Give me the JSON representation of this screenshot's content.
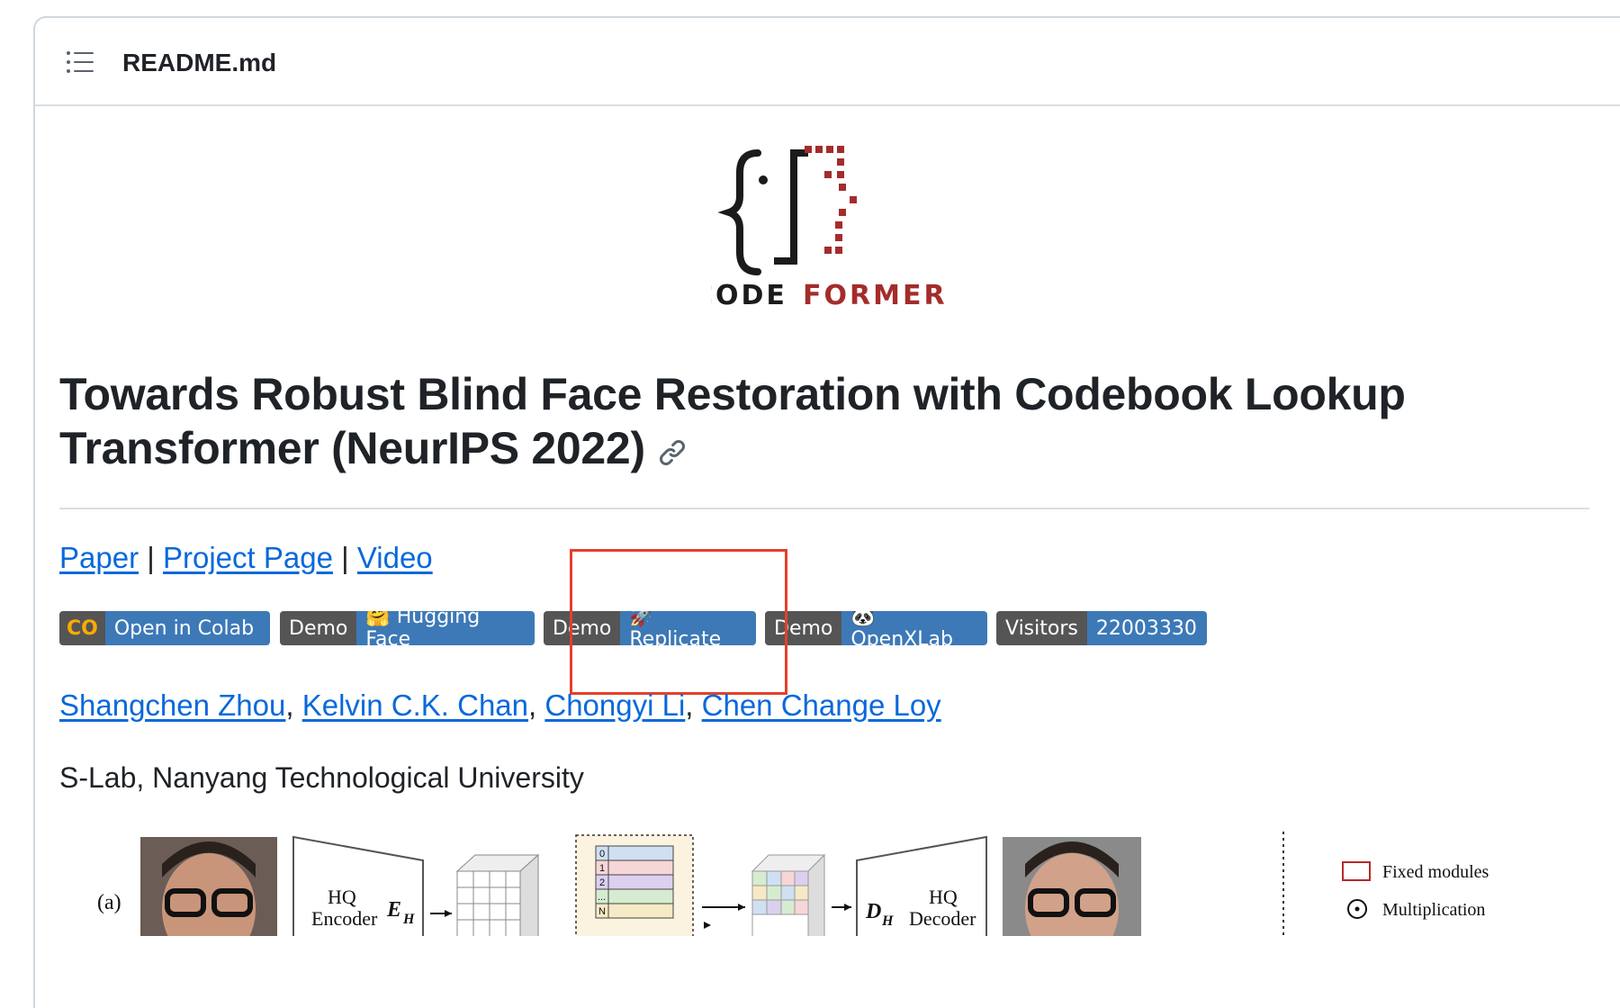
{
  "header": {
    "file_name": "README.md",
    "toc_icon": "list-unordered-icon"
  },
  "logo": {
    "text_left": "CODE",
    "text_right": "FORMER",
    "colors": {
      "dark": "#1b1b1b",
      "red": "#a42c2c"
    }
  },
  "title": {
    "text": "Towards Robust Blind Face Restoration with Codebook Lookup Transformer (NeurIPS 2022)",
    "anchor_icon": "link-icon"
  },
  "links": {
    "paper": "Paper",
    "sep": "|",
    "project": "Project Page",
    "video": "Video"
  },
  "badges": [
    {
      "left": "CO",
      "right": "Open in Colab"
    },
    {
      "left": "Demo",
      "right": "🤗 Hugging Face"
    },
    {
      "left": "Demo",
      "right": "🚀 Replicate"
    },
    {
      "left": "Demo",
      "right": "🐼 OpenXLab"
    },
    {
      "left": "Visitors",
      "right": "22003330"
    }
  ],
  "authors": [
    "Shangchen Zhou",
    "Kelvin C.K. Chan",
    "Chongyi Li",
    "Chen Change Loy"
  ],
  "author_sep": ",",
  "affiliation": "S-Lab, Nanyang Technological University",
  "figure": {
    "label": "(a)",
    "encoder_label": "HQ",
    "encoder_sub": "Encoder",
    "encoder_sym": "E",
    "encoder_sym_sub": "H",
    "decoder_label": "HQ",
    "decoder_sub": "Decoder",
    "decoder_sym": "D",
    "decoder_sym_sub": "H",
    "codebook_idx": [
      "0",
      "1",
      "2",
      "...",
      "N"
    ],
    "legend_fixed": "Fixed modules",
    "legend_mult": "Multiplication"
  },
  "highlight_color": "#e2412c"
}
